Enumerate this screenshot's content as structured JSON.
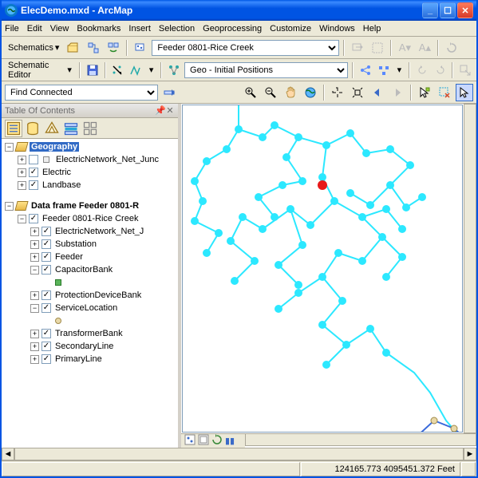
{
  "window": {
    "title": "ElecDemo.mxd - ArcMap"
  },
  "menu": [
    "File",
    "Edit",
    "View",
    "Bookmarks",
    "Insert",
    "Selection",
    "Geoprocessing",
    "Customize",
    "Windows",
    "Help"
  ],
  "toolbar1": {
    "schematics": "Schematics",
    "feeder_dropdown": "Feeder 0801-Rice Creek"
  },
  "toolbar2": {
    "editor": "Schematic Editor",
    "geo_dropdown": "Geo - Initial Positions"
  },
  "toolbar3": {
    "find": "Find Connected"
  },
  "toc": {
    "title": "Table Of Contents",
    "geography": "Geography",
    "items_geo": [
      {
        "label": "ElectricNetwork_Net_Junc",
        "checked": true,
        "checkonly": false
      },
      {
        "label": "Electric",
        "checked": true
      },
      {
        "label": "Landbase",
        "checked": true
      }
    ],
    "dataframe": "Data frame Feeder 0801-R",
    "feeder": "Feeder 0801-Rice Creek",
    "items_feeder": [
      {
        "label": "ElectricNetwork_Net_J",
        "exp": "+"
      },
      {
        "label": "Substation",
        "exp": "+"
      },
      {
        "label": "Feeder",
        "exp": "+"
      },
      {
        "label": "CapacitorBank",
        "exp": "−",
        "sym": "green-square"
      },
      {
        "label": "ProtectionDeviceBank",
        "exp": "+"
      },
      {
        "label": "ServiceLocation",
        "exp": "−",
        "sym": "tan-circle"
      },
      {
        "label": "TransformerBank",
        "exp": "+"
      },
      {
        "label": "SecondaryLine",
        "exp": "+"
      },
      {
        "label": "PrimaryLine",
        "exp": "+"
      }
    ]
  },
  "status": {
    "coords": "124165.773 4095451.372 Feet"
  }
}
